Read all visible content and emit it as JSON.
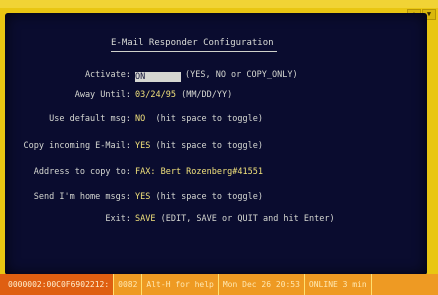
{
  "window": {
    "title": "E-Mail Responder Configuration",
    "controls": [
      "▲",
      "▼"
    ]
  },
  "form": {
    "rows": [
      {
        "label": "Activate:",
        "value": "ON",
        "hint": "(YES, NO or COPY_ONLY)"
      },
      {
        "label": "Away Until:",
        "value": "03/24/95",
        "hint": "(MM/DD/YY)"
      },
      {
        "label": "Use default msg:",
        "value": "NO",
        "hint": "(hit space to toggle)"
      },
      {
        "label": "Copy incoming E-Mail:",
        "value": "YES",
        "hint": "(hit space to toggle)"
      },
      {
        "label": "Address to copy to:",
        "value": "FAX: Bert Rozenberg#41551",
        "hint": ""
      },
      {
        "label": "Send I'm home msgs:",
        "value": "YES",
        "hint": "(hit space to toggle)"
      },
      {
        "label": "Exit:",
        "value": "SAVE",
        "hint": "(EDIT, SAVE or QUIT and hit Enter)"
      }
    ]
  },
  "statusbar": {
    "segments": [
      "0000002:00C0F6902212:",
      "0082",
      "Alt-H for help",
      "Mon Dec 26 20:53",
      "ONLINE  3 min"
    ]
  },
  "colors": {
    "frame": "#e9c612",
    "screen": "#0a0c2f",
    "label": "#d5d7d1",
    "value": "#f0e07b",
    "status": "#ee9a23"
  }
}
